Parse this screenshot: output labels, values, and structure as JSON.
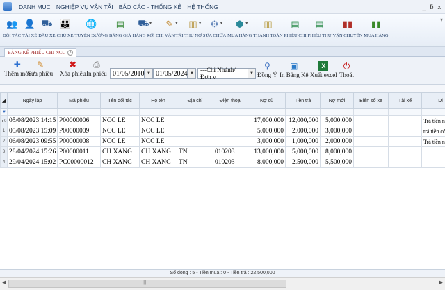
{
  "menu": [
    "DANH MỤC",
    "NGHIỆP VỤ VẬN TẢI",
    "BÁO CÁO - THỐNG KÊ",
    "HỆ THỐNG"
  ],
  "window_controls": [
    "_",
    "ƃ",
    "x"
  ],
  "ribbon": [
    {
      "label": "ĐỐI TÁC",
      "icon": "partners-icon",
      "glyph": "👥",
      "color": "#5a7fb5"
    },
    {
      "label": "TÀI XẾ",
      "icon": "driver-icon",
      "glyph": "👤",
      "color": "#c85d2a"
    },
    {
      "label": "ĐẦU XE",
      "icon": "truck-head-icon",
      "glyph": "⛟",
      "color": "#2f5f9a"
    },
    {
      "label": "CHỦ XE",
      "icon": "owner-icon",
      "glyph": "👪",
      "color": "#7a4a9a"
    },
    {
      "label": "TUYẾN ĐƯỜNG",
      "icon": "globe-icon",
      "glyph": "🌐",
      "color": "#2270c0"
    },
    {
      "label": "BẢNG GIÁ",
      "icon": "pricelist-icon",
      "glyph": "▤",
      "color": "#3a8a3a"
    },
    {
      "label": "HÀNG RỜI",
      "icon": "cargo-icon",
      "glyph": "⛟",
      "color": "#2f5f9a",
      "dropdown": true
    },
    {
      "label": "CHI VẬN TẢI",
      "icon": "transport-cost-icon",
      "glyph": "✎",
      "color": "#c0852a",
      "dropdown": true
    },
    {
      "label": "THU NỢ",
      "icon": "debt-collect-icon",
      "glyph": "▥",
      "color": "#b08a2a",
      "dropdown": true
    },
    {
      "label": "SỬA CHỮA",
      "icon": "repair-icon",
      "glyph": "⚙",
      "color": "#5a7fb5",
      "dropdown": true
    },
    {
      "label": "MUA HÀNG",
      "icon": "purchase-icon",
      "glyph": "⬢",
      "color": "#2a8a9a",
      "dropdown": true
    },
    {
      "label": "THANH TOÁN",
      "icon": "payment-icon",
      "glyph": "▥",
      "color": "#b0902a"
    },
    {
      "label": "PHIẾU CHI",
      "icon": "voucher-out-icon",
      "glyph": "▤",
      "color": "#2a8a4a"
    },
    {
      "label": "PHIẾU THU",
      "icon": "voucher-in-icon",
      "glyph": "▤",
      "color": "#2a8a4a"
    },
    {
      "label": "VẬN CHUYỂN",
      "icon": "shipping-icon",
      "glyph": "▮▮",
      "color": "#b0302a"
    },
    {
      "label": "MUA HÀNG",
      "icon": "purchase-list-icon",
      "glyph": "▮▮",
      "color": "#3a8a2a"
    }
  ],
  "tab": {
    "label": "BẢNG KÊ PHIẾU CHI NCC",
    "close": "×"
  },
  "toolbar": {
    "add": "Thêm mới",
    "edit": "Sửa phiếu",
    "delete": "Xóa phiếu",
    "print": "In phiếu",
    "from_date": "01/05/2010",
    "to_date": "01/05/2024",
    "branch": "---Chi Nhánh/Đơn v",
    "sync": "Đồng Ý",
    "print_list": "In Bảng Kê",
    "export_excel": "Xuất excel",
    "exit": "Thoát"
  },
  "table": {
    "headers": [
      "Ngày lập",
      "Mã phiếu",
      "Tên đối tác",
      "Họ tên",
      "Địa chỉ",
      "Điện thoại",
      "Nợ cũ",
      "Tiền trả",
      "Nợ mới",
      "Biển số xe",
      "Tài xế",
      "Di"
    ],
    "rows": [
      {
        "idx": "0",
        "marker": "▸",
        "cells": [
          "05/08/2023 14:15",
          "P00000006",
          "NCC LE",
          "NCC LE",
          "",
          "",
          "17,000,000",
          "12,000,000",
          "5,000,000",
          "",
          "",
          "Trả tiền nợ"
        ]
      },
      {
        "idx": "1",
        "marker": "",
        "cells": [
          "05/08/2023 15:09",
          "P00000009",
          "NCC LE",
          "NCC LE",
          "",
          "",
          "5,000,000",
          "2,000,000",
          "3,000,000",
          "",
          "",
          "trả tiền công nợ"
        ]
      },
      {
        "idx": "2",
        "marker": "",
        "cells": [
          "06/08/2023 09:55",
          "P00000008",
          "NCC LE",
          "NCC LE",
          "",
          "",
          "3,000,000",
          "1,000,000",
          "2,000,000",
          "",
          "",
          "Trả tiền nợ"
        ]
      },
      {
        "idx": "3",
        "marker": "",
        "cells": [
          "28/04/2024 15:26",
          "P00000011",
          "CH XANG",
          "CH XANG",
          "TN",
          "010203",
          "13,000,000",
          "5,000,000",
          "8,000,000",
          "",
          "",
          ""
        ]
      },
      {
        "idx": "4",
        "marker": "",
        "cells": [
          "29/04/2024 15:02",
          "PC00000012",
          "CH XANG",
          "CH XANG",
          "TN",
          "010203",
          "8,000,000",
          "2,500,000",
          "5,500,000",
          "",
          "",
          ""
        ]
      }
    ]
  },
  "footer": "Số dòng : 5 - Tiền mua : 0 - Tiền trả : 22,500,000"
}
